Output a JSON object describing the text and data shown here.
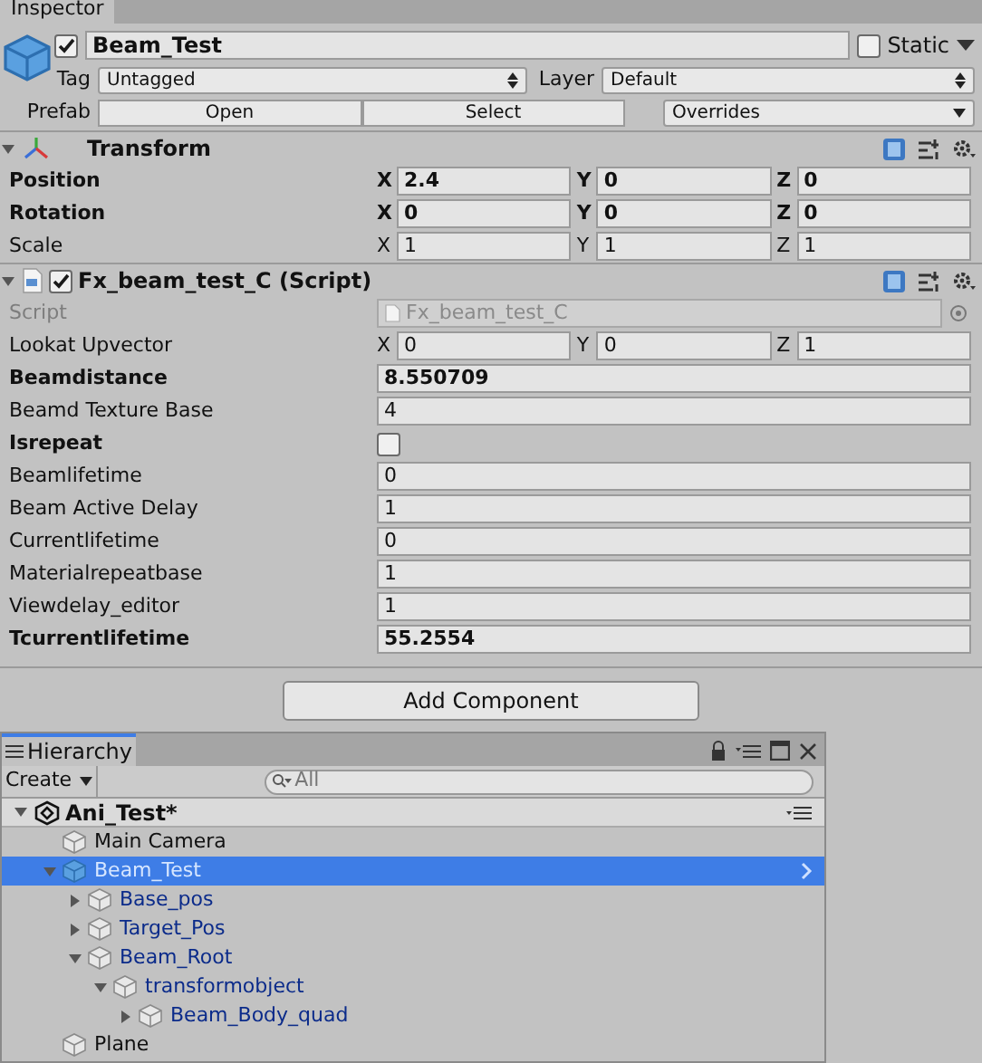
{
  "inspector": {
    "tab": "Inspector",
    "object": {
      "active": true,
      "name": "Beam_Test",
      "static": {
        "label": "Static",
        "checked": false
      }
    },
    "tag": {
      "label": "Tag",
      "value": "Untagged"
    },
    "layer": {
      "label": "Layer",
      "value": "Default"
    },
    "prefab": {
      "label": "Prefab",
      "buttons": [
        "Open",
        "Select"
      ],
      "overrides": "Overrides"
    },
    "components": [
      {
        "kind": "transform",
        "title": "Transform",
        "rows": [
          {
            "kind": "vector",
            "label": "Position",
            "bold": true,
            "axes": [
              {
                "axis": "X",
                "value": "2.4"
              },
              {
                "axis": "Y",
                "value": "0"
              },
              {
                "axis": "Z",
                "value": "0"
              }
            ]
          },
          {
            "kind": "vector",
            "label": "Rotation",
            "bold": true,
            "axes": [
              {
                "axis": "X",
                "value": "0"
              },
              {
                "axis": "Y",
                "value": "0"
              },
              {
                "axis": "Z",
                "value": "0"
              }
            ]
          },
          {
            "kind": "vector",
            "label": "Scale",
            "bold": false,
            "axes": [
              {
                "axis": "X",
                "value": "1"
              },
              {
                "axis": "Y",
                "value": "1"
              },
              {
                "axis": "Z",
                "value": "1"
              }
            ]
          }
        ]
      },
      {
        "kind": "script",
        "title": "Fx_beam_test_C (Script)",
        "enabled": true,
        "rows": [
          {
            "kind": "object",
            "label": "Script",
            "value": "Fx_beam_test_C",
            "disabled": true
          },
          {
            "kind": "vector",
            "label": "Lookat Upvector",
            "bold": false,
            "axes": [
              {
                "axis": "X",
                "value": "0"
              },
              {
                "axis": "Y",
                "value": "0"
              },
              {
                "axis": "Z",
                "value": "1"
              }
            ]
          },
          {
            "kind": "field",
            "label": "Beamdistance",
            "bold": true,
            "value": "8.550709"
          },
          {
            "kind": "field",
            "label": "Beamd Texture Base",
            "bold": false,
            "value": "4"
          },
          {
            "kind": "checkbox",
            "label": "Isrepeat",
            "bold": true,
            "checked": false
          },
          {
            "kind": "field",
            "label": "Beamlifetime",
            "bold": false,
            "value": "0"
          },
          {
            "kind": "field",
            "label": "Beam Active Delay",
            "bold": false,
            "value": "1"
          },
          {
            "kind": "field",
            "label": "Currentlifetime",
            "bold": false,
            "value": "0"
          },
          {
            "kind": "field",
            "label": "Materialrepeatbase",
            "bold": false,
            "value": "1"
          },
          {
            "kind": "field",
            "label": "Viewdelay_editor",
            "bold": false,
            "value": "1"
          },
          {
            "kind": "field",
            "label": "Tcurrentlifetime",
            "bold": true,
            "value": "55.2554"
          }
        ]
      }
    ],
    "add_button": "Add Component"
  },
  "hierarchy": {
    "tab": "Hierarchy",
    "create": "Create",
    "search": {
      "placeholder": "All"
    },
    "scene": "Ani_Test*",
    "items": [
      {
        "name": "Main Camera",
        "kind": "object",
        "selected": false
      },
      {
        "name": "Beam_Test",
        "kind": "prefab",
        "selected": true,
        "expanded": true,
        "children": [
          {
            "name": "Base_pos",
            "kind": "prefab",
            "selected": false,
            "expanded": false
          },
          {
            "name": "Target_Pos",
            "kind": "prefab",
            "selected": false,
            "expanded": false
          },
          {
            "name": "Beam_Root",
            "kind": "prefab",
            "selected": false,
            "expanded": true,
            "children": [
              {
                "name": "transformobject",
                "kind": "prefab",
                "selected": false,
                "expanded": true,
                "children": [
                  {
                    "name": "Beam_Body_quad",
                    "kind": "prefab",
                    "selected": false,
                    "expanded": false
                  }
                ]
              }
            ]
          }
        ]
      },
      {
        "name": "Plane",
        "kind": "object",
        "selected": false
      }
    ]
  }
}
